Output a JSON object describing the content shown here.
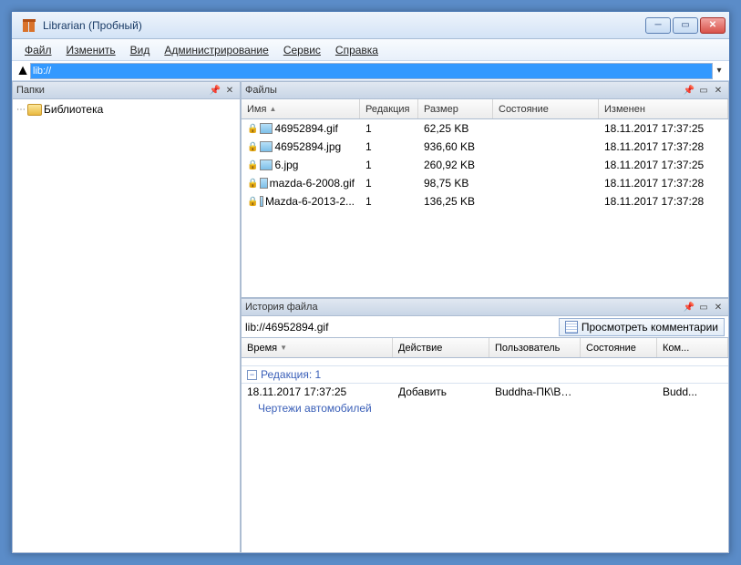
{
  "window": {
    "title": "Librarian (Пробный)"
  },
  "menu": {
    "file": "Файл",
    "edit": "Изменить",
    "view": "Вид",
    "admin": "Администрирование",
    "service": "Сервис",
    "help": "Справка"
  },
  "address": {
    "value": "lib://"
  },
  "panes": {
    "folders_title": "Папки",
    "files_title": "Файлы",
    "history_title": "История файла"
  },
  "tree": {
    "root": "Библиотека"
  },
  "file_cols": {
    "name": "Имя",
    "rev": "Редакция",
    "size": "Размер",
    "state": "Состояние",
    "modified": "Изменен"
  },
  "files": [
    {
      "name": "46952894.gif",
      "rev": "1",
      "size": "62,25 KB",
      "state": "",
      "mod": "18.11.2017 17:37:25",
      "icon": "img"
    },
    {
      "name": "46952894.jpg",
      "rev": "1",
      "size": "936,60 KB",
      "state": "",
      "mod": "18.11.2017 17:37:28",
      "icon": "img"
    },
    {
      "name": "6.jpg",
      "rev": "1",
      "size": "260,92 KB",
      "state": "",
      "mod": "18.11.2017 17:37:25",
      "icon": "img"
    },
    {
      "name": "mazda-6-2008.gif",
      "rev": "1",
      "size": "98,75 KB",
      "state": "",
      "mod": "18.11.2017 17:37:28",
      "icon": "img"
    },
    {
      "name": "Mazda-6-2013-2...",
      "rev": "1",
      "size": "136,25 KB",
      "state": "",
      "mod": "18.11.2017 17:37:28",
      "icon": "red"
    }
  ],
  "history": {
    "uri": "lib://46952894.gif",
    "view_comments": "Просмотреть комментарии",
    "cols": {
      "time": "Время",
      "action": "Действие",
      "user": "Пользователь",
      "state": "Состояние",
      "comment": "Ком..."
    },
    "rev_label": "Редакция: 1",
    "entry": {
      "time": "18.11.2017 17:37:25",
      "action": "Добавить",
      "user": "Buddha-ПК\\Bud...",
      "state": "",
      "comment": "Budd..."
    },
    "sub": "Чертежи автомобилей"
  }
}
